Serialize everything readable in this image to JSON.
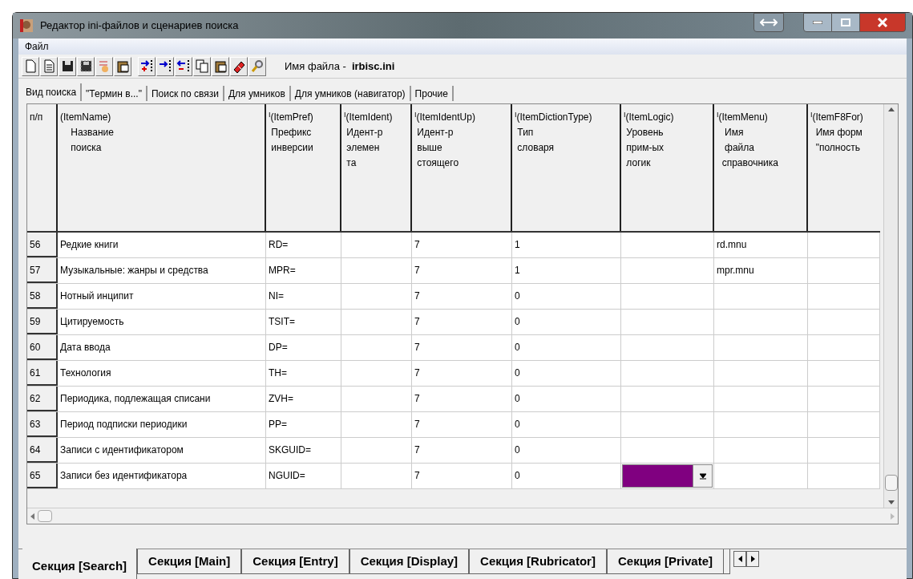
{
  "window": {
    "title": "Редактор ini-файлов и сценариев поиска"
  },
  "menu": [
    "Файл"
  ],
  "toolbar": {
    "file_label": "Имя файла - ",
    "file_name": "irbisc.ini"
  },
  "tabs": [
    {
      "label": "Вид поиска",
      "selected": true
    },
    {
      "label": "\"Термин в...\"",
      "selected": false
    },
    {
      "label": "Поиск по связи",
      "selected": false
    },
    {
      "label": "Для умников",
      "selected": false
    },
    {
      "label": "Для умников (навигатор)",
      "selected": false
    },
    {
      "label": "Прочие",
      "selected": false
    }
  ],
  "table": {
    "columns": [
      {
        "lines": [
          "п/п"
        ]
      },
      {
        "lines": [
          "(ItemName)",
          "    Название",
          "    поиска"
        ]
      },
      {
        "lines": [
          "$^{I}$(ItemPref)",
          " Префикс",
          " инверсии"
        ]
      },
      {
        "lines": [
          "$^{I}$(ItemIdent)",
          " Идент-р",
          " элемен",
          " та"
        ]
      },
      {
        "lines": [
          "$^{I}$(ItemIdentUp)",
          " Идент-р",
          " выше",
          " стоящего"
        ]
      },
      {
        "lines": [
          "$^{I}$(ItemDictionType)",
          " Тип",
          " словаря"
        ]
      },
      {
        "lines": [
          "$^{I}$(ItemLogic)",
          " Уровень",
          " прим-ых",
          " логик"
        ]
      },
      {
        "lines": [
          "$^{I}$(ItemMenu)",
          "   Имя",
          "   файла",
          "  справочника"
        ]
      },
      {
        "lines": [
          "$^{I}$(ItemF8For)",
          "  Имя форм",
          "  \"полность"
        ]
      }
    ],
    "rows": [
      {
        "cells": [
          "56",
          "Редкие книги",
          "RD=",
          "",
          "7",
          "1",
          "",
          "rd.mnu",
          ""
        ]
      },
      {
        "cells": [
          "57",
          "Музыкальные: жанры и средства",
          "MPR=",
          "",
          "7",
          "1",
          "",
          "mpr.mnu",
          ""
        ]
      },
      {
        "cells": [
          "58",
          "Нотный инципит",
          "NI=",
          "",
          "7",
          "0",
          "",
          "",
          ""
        ]
      },
      {
        "cells": [
          "59",
          "Цитируемость",
          "TSIT=",
          "",
          "7",
          "0",
          "",
          "",
          ""
        ]
      },
      {
        "cells": [
          "60",
          "Дата ввода",
          "DP=",
          "",
          "7",
          "0",
          "",
          "",
          ""
        ]
      },
      {
        "cells": [
          "61",
          "Технология",
          "TH=",
          "",
          "7",
          "0",
          "",
          "",
          ""
        ]
      },
      {
        "cells": [
          "62",
          "Периодика, подлежащая списани",
          "ZVH=",
          "",
          "7",
          "0",
          "",
          "",
          ""
        ]
      },
      {
        "cells": [
          "63",
          "Период подписки периодики",
          "PP=",
          "",
          "7",
          "0",
          "",
          "",
          ""
        ]
      },
      {
        "cells": [
          "64",
          "Записи с идентификатором",
          "SKGUID=",
          "",
          "7",
          "0",
          "",
          "",
          ""
        ]
      },
      {
        "cells": [
          "65",
          "Записи без идентификатора",
          "NGUID=",
          "",
          "7",
          "0",
          "",
          "",
          ""
        ],
        "logic_editor": {
          "color": "#800080"
        }
      }
    ]
  },
  "sections": [
    {
      "label": "Секция [Search]",
      "selected": true
    },
    {
      "label": "Секция [Main]",
      "selected": false
    },
    {
      "label": "Секция [Entry]",
      "selected": false
    },
    {
      "label": "Секция [Display]",
      "selected": false
    },
    {
      "label": "Секция [Rubricator]",
      "selected": false
    },
    {
      "label": "Секция [Private]",
      "selected": false
    }
  ]
}
